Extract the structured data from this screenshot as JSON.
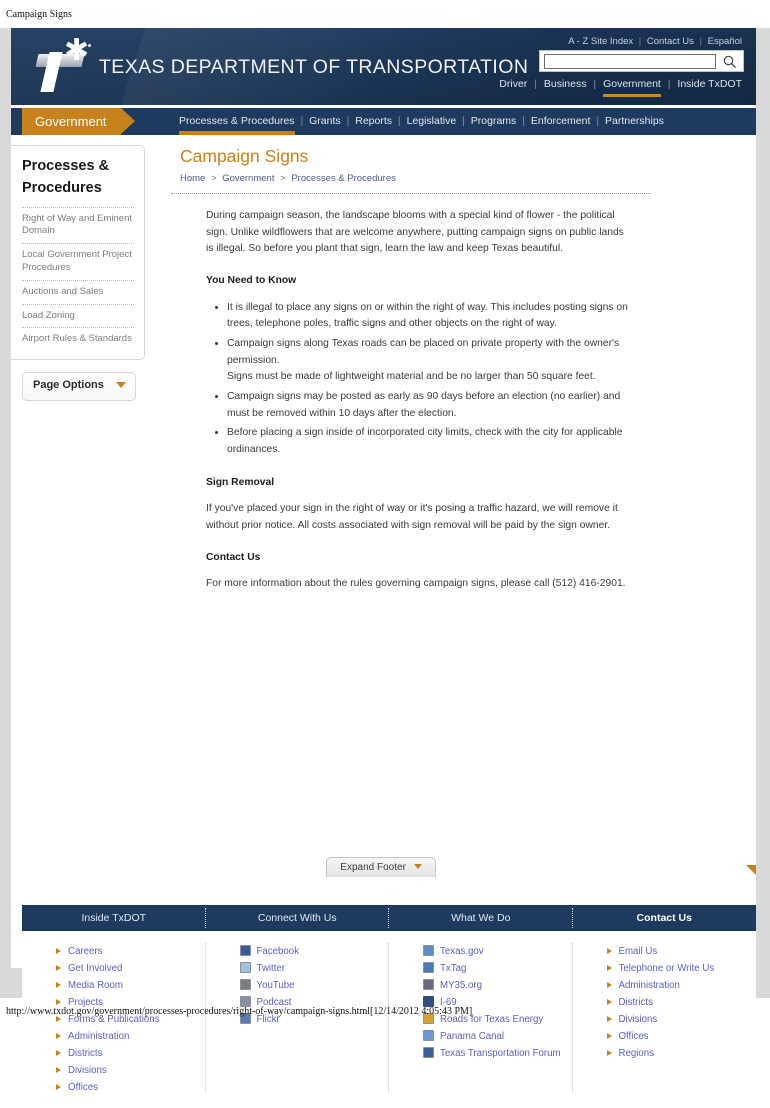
{
  "print": {
    "header_title": "Campaign Signs",
    "footer_url": "http://www.txdot.gov/government/processes-procedures/right-of-way/campaign-signs.html[12/14/2012 4:05:43 PM]"
  },
  "masthead": {
    "org_title": "TEXAS DEPARTMENT OF TRANSPORTATION",
    "util_links": [
      "A - Z Site Index",
      "Contact Us",
      "Español"
    ],
    "search": {
      "value": "",
      "placeholder": "",
      "button_icon": "search-icon"
    },
    "section_links": [
      "Driver",
      "Business",
      "Government",
      "Inside TxDOT"
    ],
    "active_section": "Government"
  },
  "navbar": {
    "tag": "Government",
    "items": [
      "Processes & Procedures",
      "Grants",
      "Reports",
      "Legislative",
      "Programs",
      "Enforcement",
      "Partnerships"
    ],
    "active_item": "Processes & Procedures"
  },
  "sidebar": {
    "title": "Processes & Procedures",
    "links": [
      "Right of Way and Eminent Domain",
      "Local Government Project Procedures",
      "Auctions and Sales",
      "Load Zoning",
      "Airport Rules & Standards"
    ],
    "page_options_label": "Page Options",
    "page_options_icon": "chevron-down-icon"
  },
  "main": {
    "title": "Campaign Signs",
    "breadcrumb": [
      "Home",
      "Government",
      "Processes & Procedures"
    ],
    "intro": "During campaign season, the landscape blooms with a special kind of flower - the political sign. Unlike wildflowers that are welcome anywhere, putting campaign signs on public lands is illegal. So before you plant that sign, learn the law and keep Texas beautiful.",
    "need_to_know_heading": "You Need to Know",
    "need_to_know_items": [
      {
        "text": "It is illegal to place any signs on or within the right of way. This includes posting signs on trees, telephone poles, traffic signs and other objects on the right of way.",
        "sub": ""
      },
      {
        "text": "Campaign signs along Texas roads can be placed on private property with the owner's permission.",
        "sub": "Signs must be made of lightweight material and be no larger than 50 square feet."
      },
      {
        "text": "Campaign signs may be posted as early as 90 days before an election (no earlier) and must be removed within 10 days after the election.",
        "sub": ""
      },
      {
        "text": "Before placing a sign inside of incorporated city limits, check with the city for applicable ordinances.",
        "sub": ""
      }
    ],
    "sign_removal_heading": "Sign Removal",
    "sign_removal_text": "If you've placed your sign in the right of way or it's posing a traffic hazard, we will remove it without prior notice. All costs associated with sign removal will be paid by the sign owner.",
    "contact_heading": "Contact Us",
    "contact_text": "For more information about the rules governing campaign signs, please call (512) 416-2901."
  },
  "expand_footer": {
    "label": "Expand Footer",
    "icon": "chevron-down-icon"
  },
  "footer": {
    "tabs": [
      {
        "label": "Inside TxDOT",
        "active": false
      },
      {
        "label": "Connect With Us",
        "active": false
      },
      {
        "label": "What We Do",
        "active": false
      },
      {
        "label": "Contact Us",
        "active": true
      }
    ],
    "columns": [
      {
        "style": "arrow",
        "items": [
          {
            "label": "Careers"
          },
          {
            "label": "Get Involved"
          },
          {
            "label": "Media Room"
          },
          {
            "label": "Projects"
          },
          {
            "label": "Forms & Publications"
          },
          {
            "label": "Administration"
          },
          {
            "label": "Districts"
          },
          {
            "label": "Divisions"
          },
          {
            "label": "Offices"
          }
        ]
      },
      {
        "style": "icon",
        "items": [
          {
            "label": "Facebook",
            "icon": "facebook-icon",
            "color": "#3b5998"
          },
          {
            "label": "Twitter",
            "icon": "twitter-icon",
            "color": "#8fb8d8"
          },
          {
            "label": "YouTube",
            "icon": "youtube-icon",
            "color": "#6e6e6e"
          },
          {
            "label": "Podcast",
            "icon": "podcast-icon",
            "color": "#7a7a8a"
          },
          {
            "label": "Flickr",
            "icon": "flickr-icon",
            "color": "#4a6ea0"
          }
        ]
      },
      {
        "style": "icon",
        "items": [
          {
            "label": "Texas.gov",
            "icon": "texasgov-icon",
            "color": "#4b7ab5"
          },
          {
            "label": "TxTag",
            "icon": "txtag-icon",
            "color": "#3f6fa5"
          },
          {
            "label": "MY35.org",
            "icon": "my35-icon",
            "color": "#5a5a6e"
          },
          {
            "label": "I-69",
            "icon": "i69-icon",
            "color": "#2f4f80"
          },
          {
            "label": "Roads for Texas Energy",
            "icon": "energy-icon",
            "color": "#c8821b"
          },
          {
            "label": "Panama Canal",
            "icon": "panama-canal-icon",
            "color": "#4a7ab0"
          },
          {
            "label": "Texas Transportation Forum",
            "icon": "forum-icon",
            "color": "#2f4f80"
          }
        ]
      },
      {
        "style": "arrow",
        "items": [
          {
            "label": "Email Us"
          },
          {
            "label": "Telephone or Write Us"
          },
          {
            "label": "Administration"
          },
          {
            "label": "Districts"
          },
          {
            "label": "Divisions"
          },
          {
            "label": "Offices"
          },
          {
            "label": "Regions"
          }
        ]
      }
    ]
  },
  "colors": {
    "navy": "#1e3a5f",
    "orange": "#c8821b",
    "link_blue": "#5b5fbf",
    "title_orange": "#c8821b"
  }
}
